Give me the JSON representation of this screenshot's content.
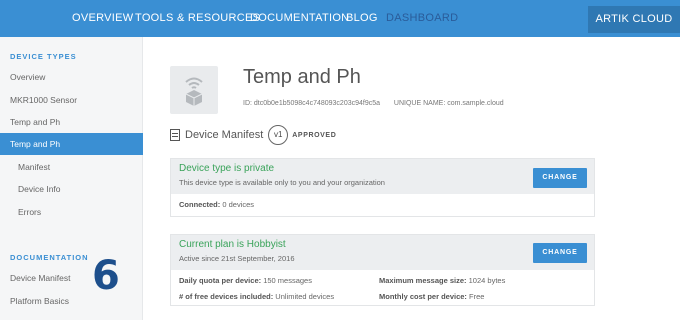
{
  "topnav": {
    "links": [
      "OVERVIEW",
      "TOOLS & RESOURCES",
      "DOCUMENTATION",
      "BLOG",
      "DASHBOARD"
    ],
    "cloud_button": "ARTIK CLOUD"
  },
  "sidebar": {
    "device_types_heading": "DEVICE TYPES",
    "items": [
      "Overview",
      "MKR1000 Sensor",
      "Temp and Ph",
      "Temp and Ph",
      "Manifest",
      "Device Info",
      "Errors"
    ],
    "documentation_heading": "DOCUMENTATION",
    "doc_items": [
      "Device Manifest",
      "Platform Basics"
    ],
    "overlay_number": "6"
  },
  "device": {
    "title": "Temp and Ph",
    "id_label": "ID:",
    "id_value": "dtc0b0e1b5098c4c748093c203c94f9c5a",
    "unique_name_label": "UNIQUE NAME:",
    "unique_name_value": "com.sample.cloud",
    "icon": "wifi-device-icon"
  },
  "manifest": {
    "label": "Device Manifest",
    "version": "v1",
    "status": "APPROVED"
  },
  "privacy_card": {
    "title": "Device type is private",
    "subtitle": "This device type is available only to you and your organization",
    "button": "CHANGE",
    "connected_label": "Connected:",
    "connected_value": "0 devices"
  },
  "plan_card": {
    "title": "Current plan is Hobbyist",
    "subtitle": "Active since 21st September, 2016",
    "button": "CHANGE",
    "quota_label": "Daily quota per device:",
    "quota_value": "150 messages",
    "max_size_label": "Maximum message size:",
    "max_size_value": "1024 bytes",
    "free_devices_label": "# of free devices included:",
    "free_devices_value": "Unlimited devices",
    "monthly_cost_label": "Monthly cost per device:",
    "monthly_cost_value": "Free"
  },
  "colors": {
    "accent": "#3a8fd3",
    "success": "#3aa35a",
    "overlay_number": "#1d4f8c"
  }
}
